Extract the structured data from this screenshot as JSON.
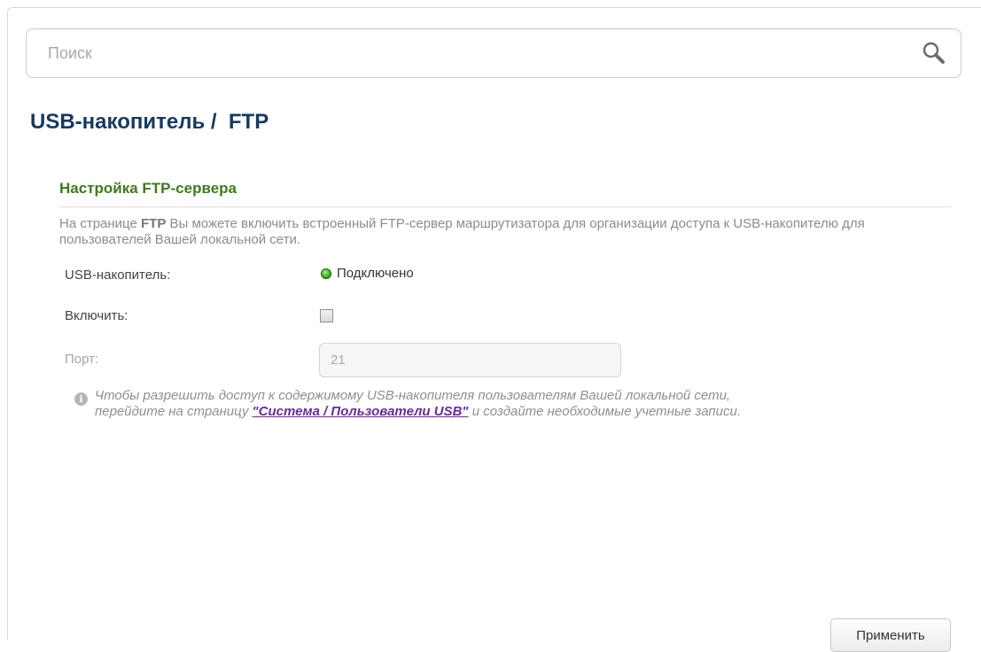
{
  "search": {
    "placeholder": "Поиск",
    "value": "",
    "icon": "search-icon"
  },
  "page": {
    "title": "USB-накопитель /  FTP"
  },
  "section": {
    "title": "Настройка FTP-сервера",
    "description_prefix": "На странице ",
    "description_bold": "FTP",
    "description_suffix": " Вы можете включить встроенный FTP-сервер маршрутизатора для организации доступа к USB-накопителю для пользователей Вашей локальной сети."
  },
  "fields": {
    "usb_label": "USB-накопитель:",
    "usb_status": "Подключено",
    "usb_status_color": "#3cbb24",
    "enable_label": "Включить:",
    "enable_checked": false,
    "port_label": "Порт:",
    "port_value": "21"
  },
  "note": {
    "icon": "info-icon",
    "text_before": "Чтобы разрешить доступ к содержимому USB-накопителя пользователям Вашей локальной сети, перейдите на страницу ",
    "link_text": "\"Система / Пользователи USB\"",
    "text_after": " и создайте необходимые учетные записи."
  },
  "actions": {
    "apply_label": "Применить"
  },
  "colors": {
    "title": "#163a5f",
    "section_title": "#3e7b1e",
    "link": "#6a2a9c"
  }
}
